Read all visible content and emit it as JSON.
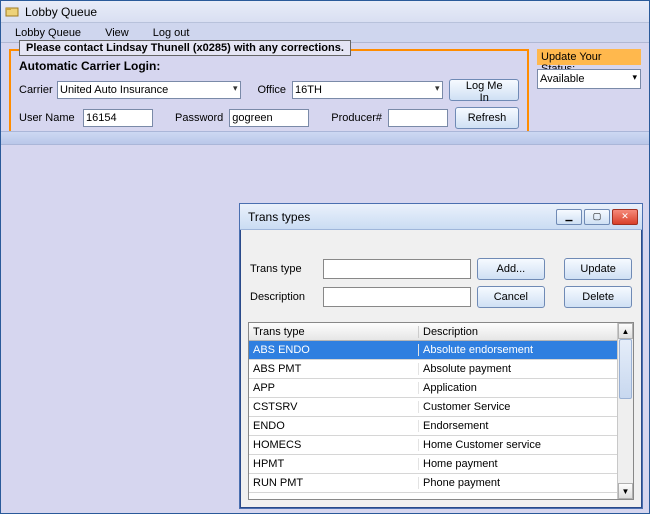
{
  "window": {
    "title": "Lobby Queue"
  },
  "menu": {
    "items": [
      "Lobby Queue",
      "View",
      "Log out"
    ]
  },
  "carrier_panel": {
    "legend": "Please contact Lindsay Thunell (x0285) with any corrections.",
    "subtitle": "Automatic Carrier Login:",
    "labels": {
      "carrier": "Carrier",
      "office": "Office",
      "username": "User Name",
      "password": "Password",
      "producer_no": "Producer#"
    },
    "values": {
      "carrier": "United Auto Insurance",
      "office": "16TH",
      "username": "16154",
      "password": "gogreen",
      "producer_no": ""
    },
    "buttons": {
      "login": "Log Me In",
      "refresh": "Refresh"
    }
  },
  "status": {
    "header": "Update Your Status:",
    "value": "Available"
  },
  "dialog": {
    "title": "Trans types",
    "labels": {
      "trans_type": "Trans type",
      "description": "Description"
    },
    "buttons": {
      "add": "Add...",
      "cancel": "Cancel",
      "update": "Update",
      "delete": "Delete"
    },
    "input": {
      "trans_type": "",
      "description": ""
    },
    "columns": {
      "c1": "Trans type",
      "c2": "Description"
    },
    "rows": [
      {
        "type": "ABS ENDO",
        "desc": "Absolute endorsement",
        "selected": true
      },
      {
        "type": "ABS PMT",
        "desc": "Absolute payment"
      },
      {
        "type": "APP",
        "desc": "Application"
      },
      {
        "type": "CSTSRV",
        "desc": "Customer Service"
      },
      {
        "type": "ENDO",
        "desc": "Endorsement"
      },
      {
        "type": "HOMECS",
        "desc": "Home Customer service"
      },
      {
        "type": "HPMT",
        "desc": "Home payment"
      },
      {
        "type": "RUN PMT",
        "desc": "Phone payment"
      }
    ]
  }
}
